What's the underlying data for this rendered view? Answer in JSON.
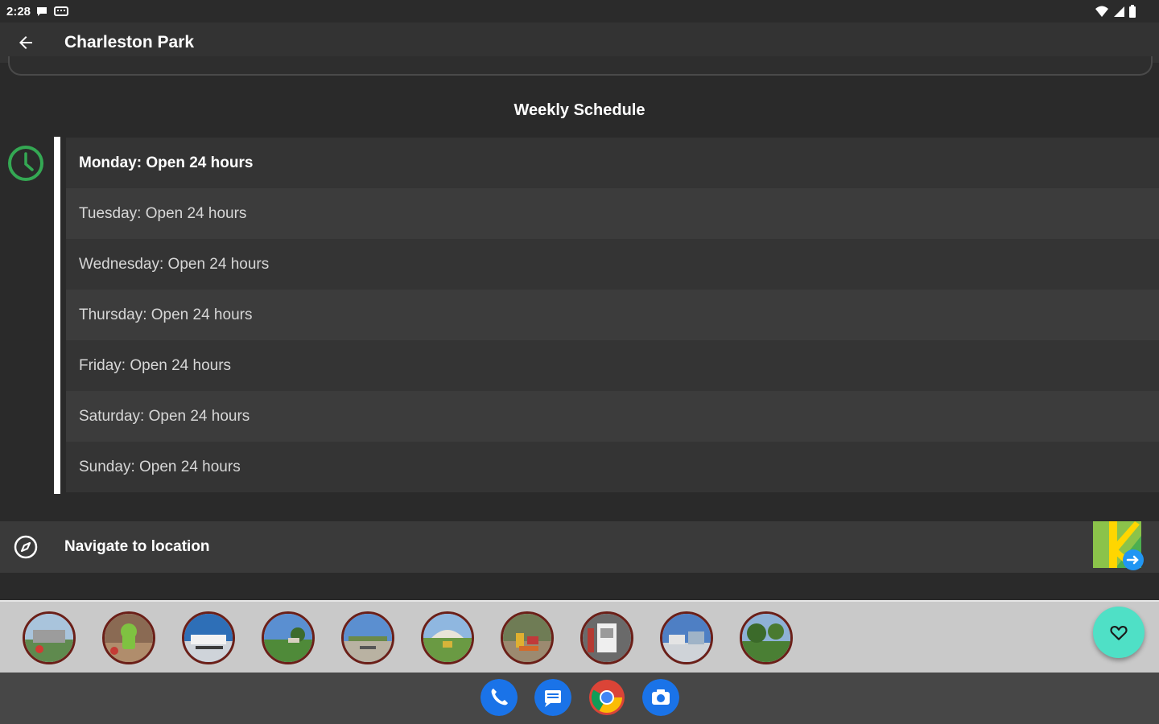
{
  "status_bar": {
    "time": "2:28",
    "left_icons": [
      "message-icon",
      "keyboard-icon"
    ],
    "right_icons": [
      "wifi-icon",
      "signal-icon",
      "battery-icon"
    ]
  },
  "app_bar": {
    "title": "Charleston Park",
    "back_icon": "back-arrow-icon"
  },
  "schedule": {
    "title": "Weekly Schedule",
    "icon": "clock-icon",
    "accent_color": "#34a853",
    "days": [
      {
        "text": "Monday: Open 24 hours",
        "current": true
      },
      {
        "text": "Tuesday: Open 24 hours",
        "current": false
      },
      {
        "text": "Wednesday: Open 24 hours",
        "current": false
      },
      {
        "text": "Thursday: Open 24 hours",
        "current": false
      },
      {
        "text": "Friday: Open 24 hours",
        "current": false
      },
      {
        "text": "Saturday: Open 24 hours",
        "current": false
      },
      {
        "text": "Sunday: Open 24 hours",
        "current": false
      }
    ]
  },
  "navigate": {
    "label": "Navigate to location",
    "icon": "compass-icon",
    "app_icon": "navigation-app-icon"
  },
  "photos": {
    "count": 10,
    "border_color": "#6b1f18"
  },
  "favorite": {
    "icon": "heart-outline-icon",
    "color": "#4fe0c6"
  },
  "dock": {
    "apps": [
      "phone-icon",
      "messages-icon",
      "chrome-icon",
      "camera-icon"
    ]
  }
}
